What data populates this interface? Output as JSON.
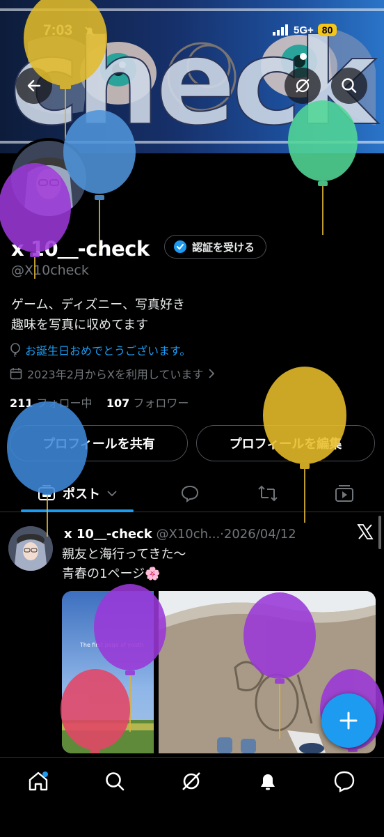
{
  "status_bar": {
    "time": "7:03",
    "network": "5G+",
    "battery": "80"
  },
  "banner": {
    "text": "check"
  },
  "profile": {
    "name": "x 10＿-check",
    "verify_label": "認証を受ける",
    "handle": "@X10check",
    "bio_line1": "ゲーム、ディズニー、写真好き",
    "bio_line2": "趣味を写真に収めてます",
    "birthday": "お誕生日おめでとうございます。",
    "joined": "2023年2月からXを利用しています",
    "following_count": "211",
    "following_label": "フォロー中",
    "followers_count": "107",
    "followers_label": "フォロワー",
    "share_button": "プロフィールを共有",
    "edit_button": "プロフィールを編集"
  },
  "tabs": [
    {
      "label": "ポスト",
      "icon": "posts-icon",
      "active": true
    },
    {
      "label": "",
      "icon": "reply-icon"
    },
    {
      "label": "",
      "icon": "repost-icon"
    },
    {
      "label": "",
      "icon": "media-icon"
    }
  ],
  "post": {
    "author": "x 10＿-check",
    "handle_date": "@X10ch...·2026/04/12",
    "text": "親友と海行ってきた〜\n青春の1ページ🌸",
    "media_caption": "The first page of youth"
  },
  "bottom_nav": [
    "home-icon",
    "search-icon",
    "grok-icon",
    "notifications-icon",
    "messages-icon"
  ],
  "colors": {
    "accent": "#1d9bf0",
    "background": "#000000",
    "muted": "#71767b"
  }
}
